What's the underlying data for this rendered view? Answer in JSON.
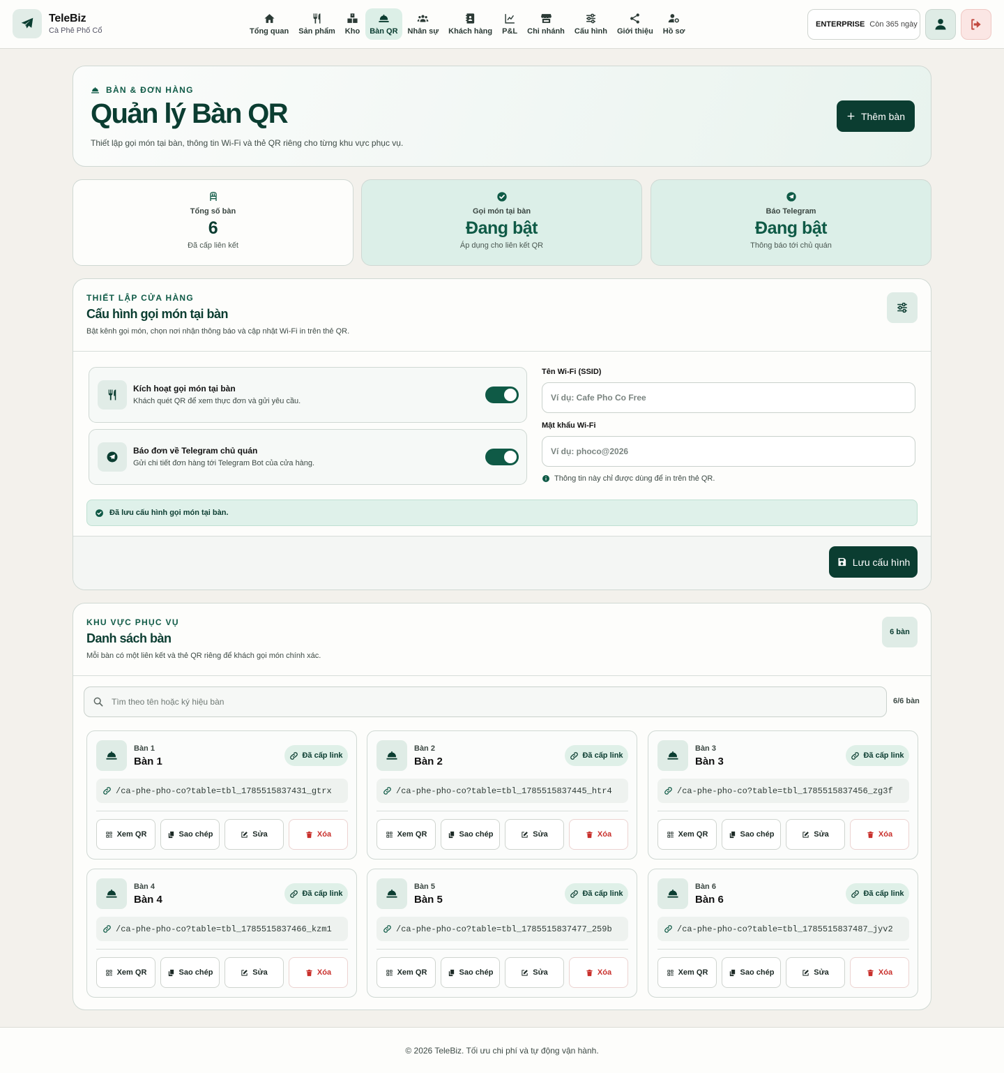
{
  "app": {
    "name": "TeleBiz",
    "store": "Cà Phê Phố Cổ"
  },
  "nav": [
    {
      "label": "Tổng quan",
      "icon": "home-icon"
    },
    {
      "label": "Sản phẩm",
      "icon": "utensils-icon"
    },
    {
      "label": "Kho",
      "icon": "boxes-icon"
    },
    {
      "label": "Bàn QR",
      "icon": "bell-service-icon",
      "active": true
    },
    {
      "label": "Nhân sự",
      "icon": "users-icon"
    },
    {
      "label": "Khách hàng",
      "icon": "contact-book-icon"
    },
    {
      "label": "P&L",
      "icon": "chart-line-icon"
    },
    {
      "label": "Chi nhánh",
      "icon": "store-icon"
    },
    {
      "label": "Cấu hình",
      "icon": "sliders-icon"
    },
    {
      "label": "Giới thiệu",
      "icon": "share-icon"
    },
    {
      "label": "Hồ sơ",
      "icon": "user-gear-icon"
    }
  ],
  "plan": {
    "name": "ENTERPRISE",
    "remaining": "Còn 365 ngày"
  },
  "hero": {
    "eyebrow": "BÀN & ĐƠN HÀNG",
    "title": "Quản lý Bàn QR",
    "desc": "Thiết lập gọi món tại bàn, thông tin Wi-Fi và thẻ QR riêng cho từng khu vực phục vụ.",
    "add_label": "Thêm bàn"
  },
  "stats": [
    {
      "label": "Tổng số bàn",
      "value": "6",
      "note": "Đã cấp liên kết"
    },
    {
      "label": "Gọi món tại bàn",
      "value": "Đang bật",
      "note": "Áp dụng cho liên kết QR"
    },
    {
      "label": "Báo Telegram",
      "value": "Đang bật",
      "note": "Thông báo tới chủ quán"
    }
  ],
  "config": {
    "eyebrow": "THIẾT LẬP CỬA HÀNG",
    "title": "Cấu hình gọi món tại bàn",
    "desc": "Bật kênh gọi món, chọn nơi nhận thông báo và cập nhật Wi-Fi in trên thẻ QR.",
    "toggles": [
      {
        "title": "Kích hoạt gọi món tại bàn",
        "desc": "Khách quét QR để xem thực đơn và gửi yêu cầu.",
        "on": true
      },
      {
        "title": "Báo đơn về Telegram chủ quán",
        "desc": "Gửi chi tiết đơn hàng tới Telegram Bot của cửa hàng.",
        "on": true
      }
    ],
    "wifi_ssid_label": "Tên Wi-Fi (SSID)",
    "wifi_ssid_placeholder": "Ví dụ: Cafe Pho Co Free",
    "wifi_ssid_value": "",
    "wifi_pass_label": "Mật khẩu Wi-Fi",
    "wifi_pass_placeholder": "Ví dụ: phoco@2026",
    "wifi_pass_value": "",
    "wifi_note": "Thông tin này chỉ được dùng để in trên thẻ QR.",
    "alert": "Đã lưu cấu hình gọi món tại bàn.",
    "save_label": "Lưu cấu hình"
  },
  "tables": {
    "eyebrow": "KHU VỰC PHỤC VỤ",
    "title": "Danh sách bàn",
    "desc": "Mỗi bàn có một liên kết và thẻ QR riêng để khách gọi món chính xác.",
    "count_badge": "6 bàn",
    "search_placeholder": "Tìm theo tên hoặc ký hiệu bàn",
    "search_count": "6/6 bàn",
    "linked_label": "Đã cấp link",
    "actions": {
      "qr": "Xem QR",
      "copy": "Sao chép",
      "edit": "Sửa",
      "delete": "Xóa"
    },
    "items": [
      {
        "code": "Bàn 1",
        "name": "Bàn 1",
        "url": "/ca-phe-pho-co?table=tbl_1785515837431_gtrx"
      },
      {
        "code": "Bàn 2",
        "name": "Bàn 2",
        "url": "/ca-phe-pho-co?table=tbl_1785515837445_htr4"
      },
      {
        "code": "Bàn 3",
        "name": "Bàn 3",
        "url": "/ca-phe-pho-co?table=tbl_1785515837456_zg3f"
      },
      {
        "code": "Bàn 4",
        "name": "Bàn 4",
        "url": "/ca-phe-pho-co?table=tbl_1785515837466_kzm1"
      },
      {
        "code": "Bàn 5",
        "name": "Bàn 5",
        "url": "/ca-phe-pho-co?table=tbl_1785515837477_259b"
      },
      {
        "code": "Bàn 6",
        "name": "Bàn 6",
        "url": "/ca-phe-pho-co?table=tbl_1785515837487_jyv2"
      }
    ]
  },
  "footer": "© 2026 TeleBiz. Tối ưu chi phí và tự động vận hành.",
  "colors": {
    "primary": "#0b3d31",
    "accent": "#0f5a46",
    "tint": "#e1f1ea",
    "danger": "#c9302c"
  }
}
